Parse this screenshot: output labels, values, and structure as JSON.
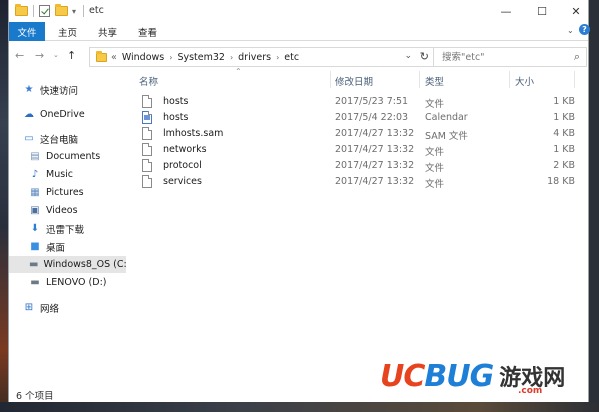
{
  "window": {
    "title": "etc",
    "controls": {
      "minimize": "—",
      "maximize": "☐",
      "close": "✕"
    }
  },
  "ribbon": {
    "tabs": [
      "文件",
      "主页",
      "共享",
      "查看"
    ]
  },
  "nav": {
    "back": "←",
    "forward": "→",
    "up": "↑"
  },
  "address": {
    "prefix": "«",
    "crumbs": [
      "Windows",
      "System32",
      "drivers",
      "etc"
    ],
    "dropdown": "⌄",
    "refresh": "↻"
  },
  "search": {
    "placeholder": "搜索\"etc\"",
    "icon": "⌕"
  },
  "sidebar": {
    "items": [
      {
        "label": "快速访问",
        "icon": "star-icon",
        "glyph": "★",
        "color": "#3b7bd6"
      },
      {
        "label": "OneDrive",
        "icon": "cloud-icon",
        "glyph": "☁",
        "color": "#2a6fc4"
      },
      {
        "label": "这台电脑",
        "icon": "computer-icon",
        "glyph": "▭",
        "color": "#3a86d4"
      },
      {
        "label": "Documents",
        "icon": "documents-icon",
        "glyph": "▤",
        "color": "#6f8fb8"
      },
      {
        "label": "Music",
        "icon": "music-icon",
        "glyph": "♪",
        "color": "#2a6fc4"
      },
      {
        "label": "Pictures",
        "icon": "pictures-icon",
        "glyph": "▦",
        "color": "#5b88c0"
      },
      {
        "label": "Videos",
        "icon": "videos-icon",
        "glyph": "▣",
        "color": "#4a6fa0"
      },
      {
        "label": "迅雷下载",
        "icon": "download-icon",
        "glyph": "⬇",
        "color": "#2a7fd4"
      },
      {
        "label": "桌面",
        "icon": "desktop-icon",
        "glyph": "■",
        "color": "#3a8fe0"
      },
      {
        "label": "Windows8_OS (C:",
        "icon": "drive-icon",
        "glyph": "▬",
        "color": "#6c7a88"
      },
      {
        "label": "LENOVO (D:)",
        "icon": "drive-icon",
        "glyph": "▬",
        "color": "#6c7a88"
      },
      {
        "label": "网络",
        "icon": "network-icon",
        "glyph": "⊞",
        "color": "#2a6fc4"
      }
    ]
  },
  "columns": [
    "名称",
    "修改日期",
    "类型",
    "大小"
  ],
  "files": [
    {
      "name": "hosts",
      "date": "2017/5/23 7:51",
      "type": "文件",
      "size": "1 KB",
      "icon": "file-icon"
    },
    {
      "name": "hosts",
      "date": "2017/5/4 22:03",
      "type": "Calendar",
      "size": "1 KB",
      "icon": "calendar-file-icon"
    },
    {
      "name": "lmhosts.sam",
      "date": "2017/4/27 13:32",
      "type": "SAM 文件",
      "size": "4 KB",
      "icon": "file-icon"
    },
    {
      "name": "networks",
      "date": "2017/4/27 13:32",
      "type": "文件",
      "size": "1 KB",
      "icon": "file-icon"
    },
    {
      "name": "protocol",
      "date": "2017/4/27 13:32",
      "type": "文件",
      "size": "2 KB",
      "icon": "file-icon"
    },
    {
      "name": "services",
      "date": "2017/4/27 13:32",
      "type": "文件",
      "size": "18 KB",
      "icon": "file-icon"
    }
  ],
  "status": {
    "count": "6 个项目"
  },
  "watermark": {
    "logo_uc": "UC",
    "logo_bug": "BUG",
    "cn": "游戏网",
    "url": ".com",
    "colors": {
      "uc": "#e8431f",
      "bug": "#1e7fd6"
    }
  }
}
